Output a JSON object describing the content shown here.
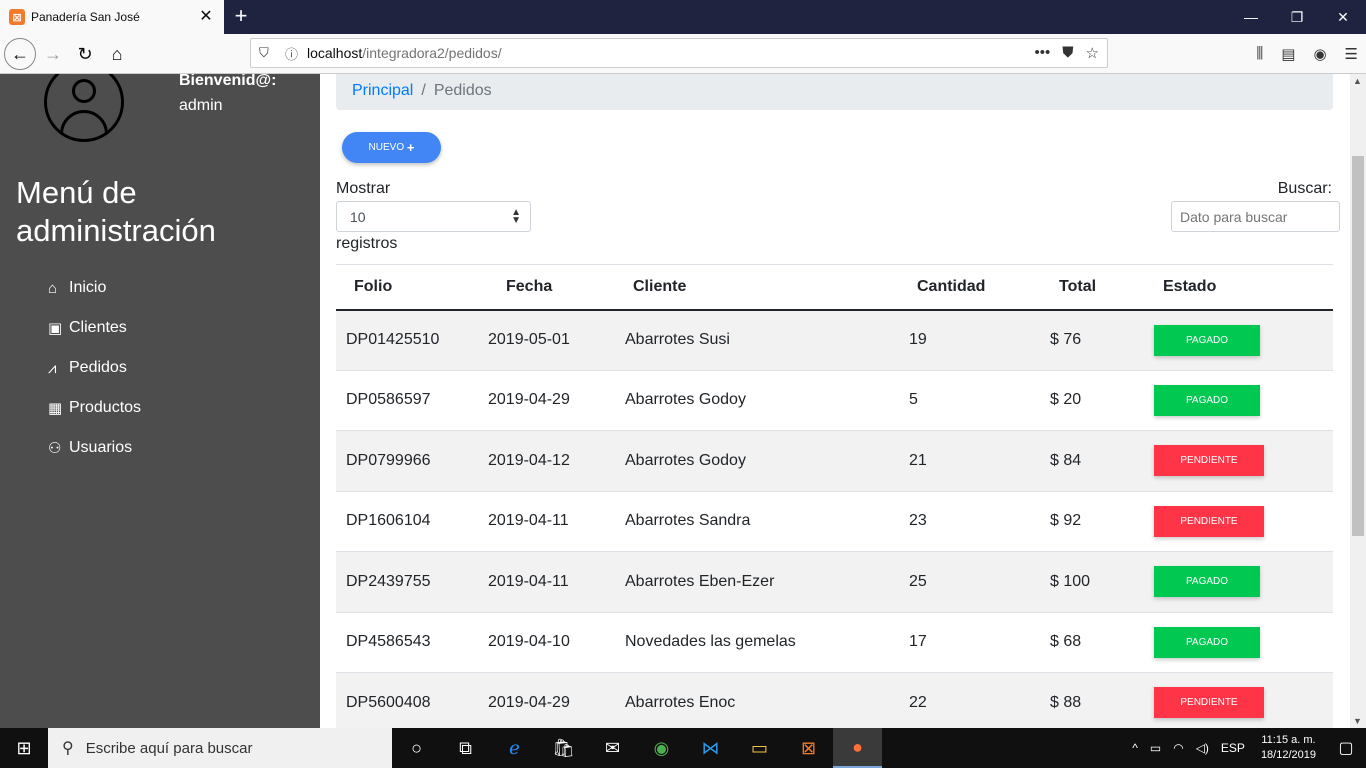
{
  "browser": {
    "tab_title": "Panadería San José",
    "tab_favicon": "⊠",
    "url_host": "localhost",
    "url_path": "/integradora2/pedidos/"
  },
  "sidebar": {
    "welcome": "Bienvenid@:",
    "username": "admin",
    "menu_title": "Menú de administración",
    "items": [
      {
        "label": "Inicio",
        "icon": "home-icon"
      },
      {
        "label": "Clientes",
        "icon": "address-card-icon"
      },
      {
        "label": "Pedidos",
        "icon": "chart-line-icon"
      },
      {
        "label": "Productos",
        "icon": "box-icon"
      },
      {
        "label": "Usuarios",
        "icon": "users-icon"
      }
    ]
  },
  "breadcrumb": {
    "home": "Principal",
    "separator": "/",
    "current": "Pedidos"
  },
  "toolbar": {
    "nuevo_label": "NUEVO"
  },
  "table_controls": {
    "mostrar": "Mostrar",
    "page_length": "10",
    "registros": "registros",
    "buscar": "Buscar:",
    "search_placeholder": "Dato para buscar"
  },
  "table": {
    "headers": [
      "Folio",
      "Fecha",
      "Cliente",
      "Cantidad",
      "Total",
      "Estado"
    ],
    "rows": [
      {
        "folio": "DP01425510",
        "fecha": "2019-05-01",
        "cliente": "Abarrotes Susi",
        "cantidad": "19",
        "total": "$ 76",
        "estado": "PAGADO"
      },
      {
        "folio": "DP0586597",
        "fecha": "2019-04-29",
        "cliente": "Abarrotes Godoy",
        "cantidad": "5",
        "total": "$ 20",
        "estado": "PAGADO"
      },
      {
        "folio": "DP0799966",
        "fecha": "2019-04-12",
        "cliente": "Abarrotes Godoy",
        "cantidad": "21",
        "total": "$ 84",
        "estado": "PENDIENTE"
      },
      {
        "folio": "DP1606104",
        "fecha": "2019-04-11",
        "cliente": "Abarrotes Sandra",
        "cantidad": "23",
        "total": "$ 92",
        "estado": "PENDIENTE"
      },
      {
        "folio": "DP2439755",
        "fecha": "2019-04-11",
        "cliente": "Abarrotes Eben-Ezer",
        "cantidad": "25",
        "total": "$ 100",
        "estado": "PAGADO"
      },
      {
        "folio": "DP4586543",
        "fecha": "2019-04-10",
        "cliente": "Novedades las gemelas",
        "cantidad": "17",
        "total": "$ 68",
        "estado": "PAGADO"
      },
      {
        "folio": "DP5600408",
        "fecha": "2019-04-29",
        "cliente": "Abarrotes Enoc",
        "cantidad": "22",
        "total": "$ 88",
        "estado": "PENDIENTE"
      }
    ]
  },
  "colors": {
    "pagado": "#00c851",
    "pendiente": "#ff3547",
    "primary": "#4285f4",
    "sidebar_bg": "#4d4d4d"
  },
  "taskbar": {
    "search_placeholder": "Escribe aquí para buscar",
    "language": "ESP",
    "time": "11:15 a. m.",
    "date": "18/12/2019"
  }
}
